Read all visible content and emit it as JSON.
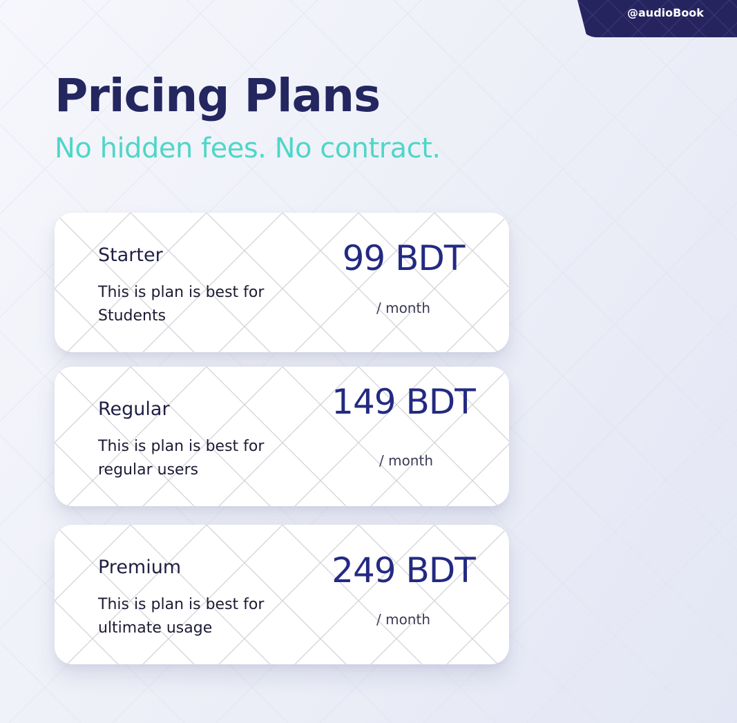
{
  "brand": {
    "handle": "@audioBook"
  },
  "header": {
    "title": "Pricing Plans",
    "subtitle": "No hidden fees. No contract."
  },
  "plans": [
    {
      "name": "Starter",
      "description": "This is plan is best for Students",
      "price": "99 BDT",
      "period": "/ month"
    },
    {
      "name": "Regular",
      "description": "This is plan is best for regular users",
      "price": "149 BDT",
      "period": "/ month"
    },
    {
      "name": "Premium",
      "description": "This is plan is best for ultimate usage",
      "price": "249 BDT",
      "period": "/ month"
    }
  ],
  "colors": {
    "title": "#242660",
    "subtitle": "#4fd6c8",
    "price": "#232a82",
    "brand_tab": "#26245f",
    "card_background": "#ffffff"
  }
}
